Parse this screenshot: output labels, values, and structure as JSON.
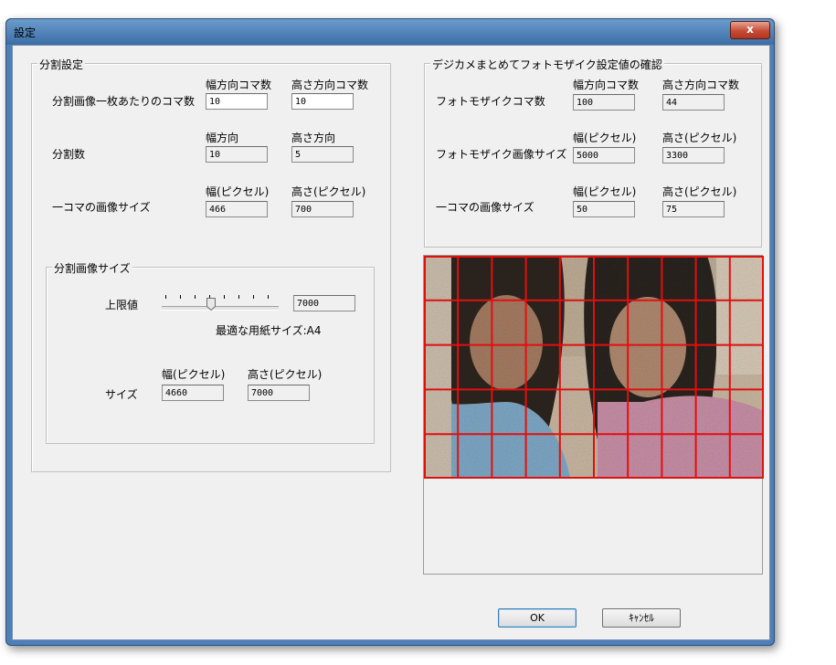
{
  "window": {
    "title": "設定",
    "close_label": "x"
  },
  "split_settings": {
    "title": "分割設定",
    "per_image_label": "分割画像一枚あたりのコマ数",
    "col_width_dir": "幅方向コマ数",
    "col_height_dir": "高さ方向コマ数",
    "per_image_width": "10",
    "per_image_height": "10",
    "split_count_label": "分割数",
    "col_width": "幅方向",
    "col_height": "高さ方向",
    "split_count_width": "10",
    "split_count_height": "5",
    "frame_size_label": "一コマの画像サイズ",
    "col_width_px": "幅(ピクセル)",
    "col_height_px": "高さ(ピクセル)",
    "frame_width": "466",
    "frame_height": "700"
  },
  "image_size": {
    "title": "分割画像サイズ",
    "max_label": "上限値",
    "max_value": "7000",
    "slider_level": 0.45,
    "paper_label": "最適な用紙サイズ:A4",
    "col_width_px": "幅(ピクセル)",
    "col_height_px": "高さ(ピクセル)",
    "size_label": "サイズ",
    "width": "4660",
    "height": "7000"
  },
  "confirm": {
    "title": "デジカメまとめてフォトモザイク設定値の確認",
    "count_label": "フォトモザイクコマ数",
    "col_width_dir": "幅方向コマ数",
    "col_height_dir": "高さ方向コマ数",
    "count_width": "100",
    "count_height": "44",
    "image_size_label": "フォトモザイク画像サイズ",
    "col_width_px": "幅(ピクセル)",
    "col_height_px": "高さ(ピクセル)",
    "image_width": "5000",
    "image_height": "3300",
    "frame_size_label": "一コマの画像サイズ",
    "col_width_px2": "幅(ピクセル)",
    "col_height_px2": "高さ(ピクセル)",
    "frame_width": "50",
    "frame_height": "75"
  },
  "preview": {
    "grid_columns": 10,
    "grid_rows": 5,
    "grid_color": "#e01010"
  },
  "buttons": {
    "ok": "OK",
    "cancel": "ｷｬﾝｾﾙ"
  }
}
